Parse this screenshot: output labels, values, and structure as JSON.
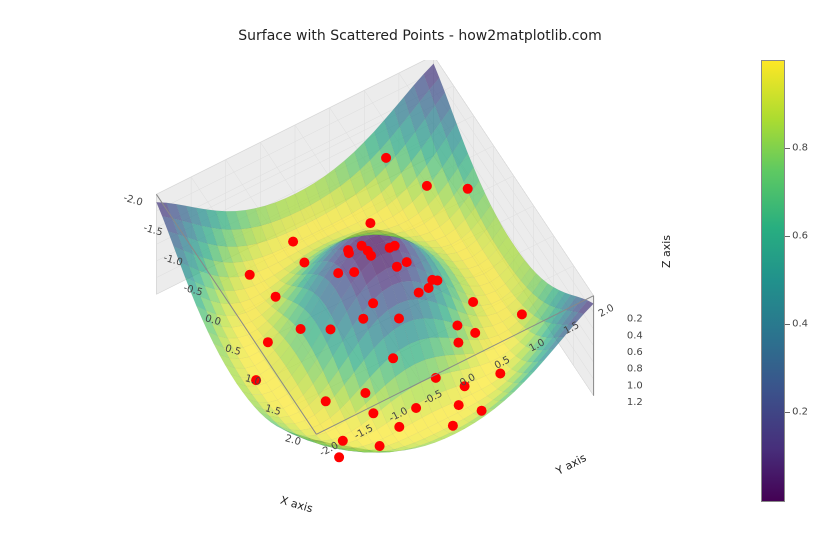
{
  "chart_data": {
    "type": "surface3d_with_scatter",
    "title": "Surface with Scattered Points - how2matplotlib.com",
    "xlabel": "X axis",
    "ylabel": "Y axis",
    "zlabel": "Z axis",
    "x_range": [
      -2.0,
      2.0
    ],
    "y_range": [
      -2.0,
      2.0
    ],
    "z_range": [
      0.0,
      1.2
    ],
    "x_ticks": [
      -2.0,
      -1.5,
      -1.0,
      -0.5,
      0.0,
      0.5,
      1.0,
      1.5,
      2.0
    ],
    "y_ticks": [
      -2.0,
      -1.5,
      -1.0,
      -0.5,
      0.0,
      0.5,
      1.0,
      1.5,
      2.0
    ],
    "z_ticks": [
      0.2,
      0.4,
      0.6,
      0.8,
      1.0,
      1.2
    ],
    "surface_function": "sin(sqrt(x^2+y^2))^2",
    "surface_grid": {
      "x": [
        -2.0,
        -1.5,
        -1.0,
        -0.5,
        0.0,
        0.5,
        1.0,
        1.5,
        2.0
      ],
      "y": [
        -2.0,
        -1.5,
        -1.0,
        -0.5,
        0.0,
        0.5,
        1.0,
        1.5,
        2.0
      ],
      "z": [
        [
          0.101,
          0.31,
          0.634,
          0.889,
          0.827,
          0.889,
          0.634,
          0.31,
          0.101
        ],
        [
          0.31,
          0.602,
          0.924,
          0.999,
          0.995,
          0.999,
          0.924,
          0.602,
          0.31
        ],
        [
          0.634,
          0.924,
          0.976,
          0.904,
          0.708,
          0.904,
          0.976,
          0.924,
          0.634
        ],
        [
          0.889,
          0.999,
          0.904,
          0.413,
          0.23,
          0.413,
          0.904,
          0.999,
          0.889
        ],
        [
          0.827,
          0.995,
          0.708,
          0.23,
          0.0,
          0.23,
          0.708,
          0.995,
          0.827
        ],
        [
          0.889,
          0.999,
          0.904,
          0.413,
          0.23,
          0.413,
          0.904,
          0.999,
          0.889
        ],
        [
          0.634,
          0.924,
          0.976,
          0.904,
          0.708,
          0.904,
          0.976,
          0.924,
          0.634
        ],
        [
          0.31,
          0.602,
          0.924,
          0.999,
          0.995,
          0.999,
          0.924,
          0.602,
          0.31
        ],
        [
          0.101,
          0.31,
          0.634,
          0.889,
          0.827,
          0.889,
          0.634,
          0.31,
          0.101
        ]
      ]
    },
    "colormap": "viridis",
    "surface_alpha": 0.7,
    "scatter": {
      "color": "red",
      "marker_size": 50,
      "n_points": 50,
      "points_xyz": [
        [
          -1.8,
          1.2,
          0.65
        ],
        [
          -1.5,
          0.8,
          1.05
        ],
        [
          -1.3,
          1.5,
          0.75
        ],
        [
          -1.0,
          0.2,
          0.8
        ],
        [
          -0.9,
          -0.5,
          0.55
        ],
        [
          -0.8,
          1.8,
          0.55
        ],
        [
          -0.6,
          -1.2,
          1.0
        ],
        [
          -0.5,
          0.5,
          0.5
        ],
        [
          -0.4,
          -0.3,
          0.4
        ],
        [
          -0.3,
          1.0,
          0.95
        ],
        [
          -0.2,
          -1.6,
          1.0
        ],
        [
          -0.1,
          0.0,
          0.1
        ],
        [
          0.0,
          0.9,
          0.7
        ],
        [
          0.1,
          -0.7,
          0.55
        ],
        [
          0.2,
          1.3,
          0.98
        ],
        [
          0.3,
          -0.2,
          0.3
        ],
        [
          0.4,
          0.4,
          0.35
        ],
        [
          0.5,
          -1.0,
          1.0
        ],
        [
          0.6,
          0.0,
          0.35
        ],
        [
          0.7,
          0.8,
          0.9
        ],
        [
          0.8,
          -0.6,
          0.85
        ],
        [
          0.9,
          1.6,
          0.75
        ],
        [
          1.0,
          0.3,
          0.9
        ],
        [
          1.1,
          -1.1,
          1.0
        ],
        [
          1.2,
          0.6,
          0.98
        ],
        [
          1.3,
          -0.4,
          0.98
        ],
        [
          1.4,
          1.0,
          0.85
        ],
        [
          1.5,
          -0.8,
          0.9
        ],
        [
          1.6,
          0.2,
          1.0
        ],
        [
          1.7,
          -1.5,
          0.6
        ],
        [
          1.8,
          0.5,
          0.8
        ],
        [
          -1.7,
          -0.2,
          1.0
        ],
        [
          -1.4,
          -1.0,
          0.85
        ],
        [
          -1.2,
          0.5,
          0.98
        ],
        [
          -1.1,
          -0.8,
          0.98
        ],
        [
          -0.7,
          0.3,
          0.6
        ],
        [
          -0.5,
          -0.1,
          0.28
        ],
        [
          0.0,
          -0.3,
          0.1
        ],
        [
          0.2,
          0.2,
          0.1
        ],
        [
          0.4,
          -0.4,
          0.33
        ],
        [
          0.6,
          1.1,
          0.98
        ],
        [
          0.8,
          -0.2,
          0.6
        ],
        [
          1.0,
          -0.6,
          0.95
        ],
        [
          1.2,
          -0.1,
          0.95
        ],
        [
          1.4,
          0.4,
          0.98
        ],
        [
          -0.3,
          -0.9,
          0.75
        ],
        [
          0.5,
          0.9,
          0.88
        ],
        [
          0.3,
          0.6,
          0.45
        ],
        [
          -0.2,
          0.4,
          0.22
        ],
        [
          0.1,
          0.4,
          0.2
        ]
      ]
    },
    "colorbar": {
      "ticks": [
        0.2,
        0.4,
        0.6,
        0.8
      ],
      "range": [
        0.0,
        1.0
      ]
    },
    "view": {
      "elevation": 30,
      "azimuth": -60
    }
  }
}
